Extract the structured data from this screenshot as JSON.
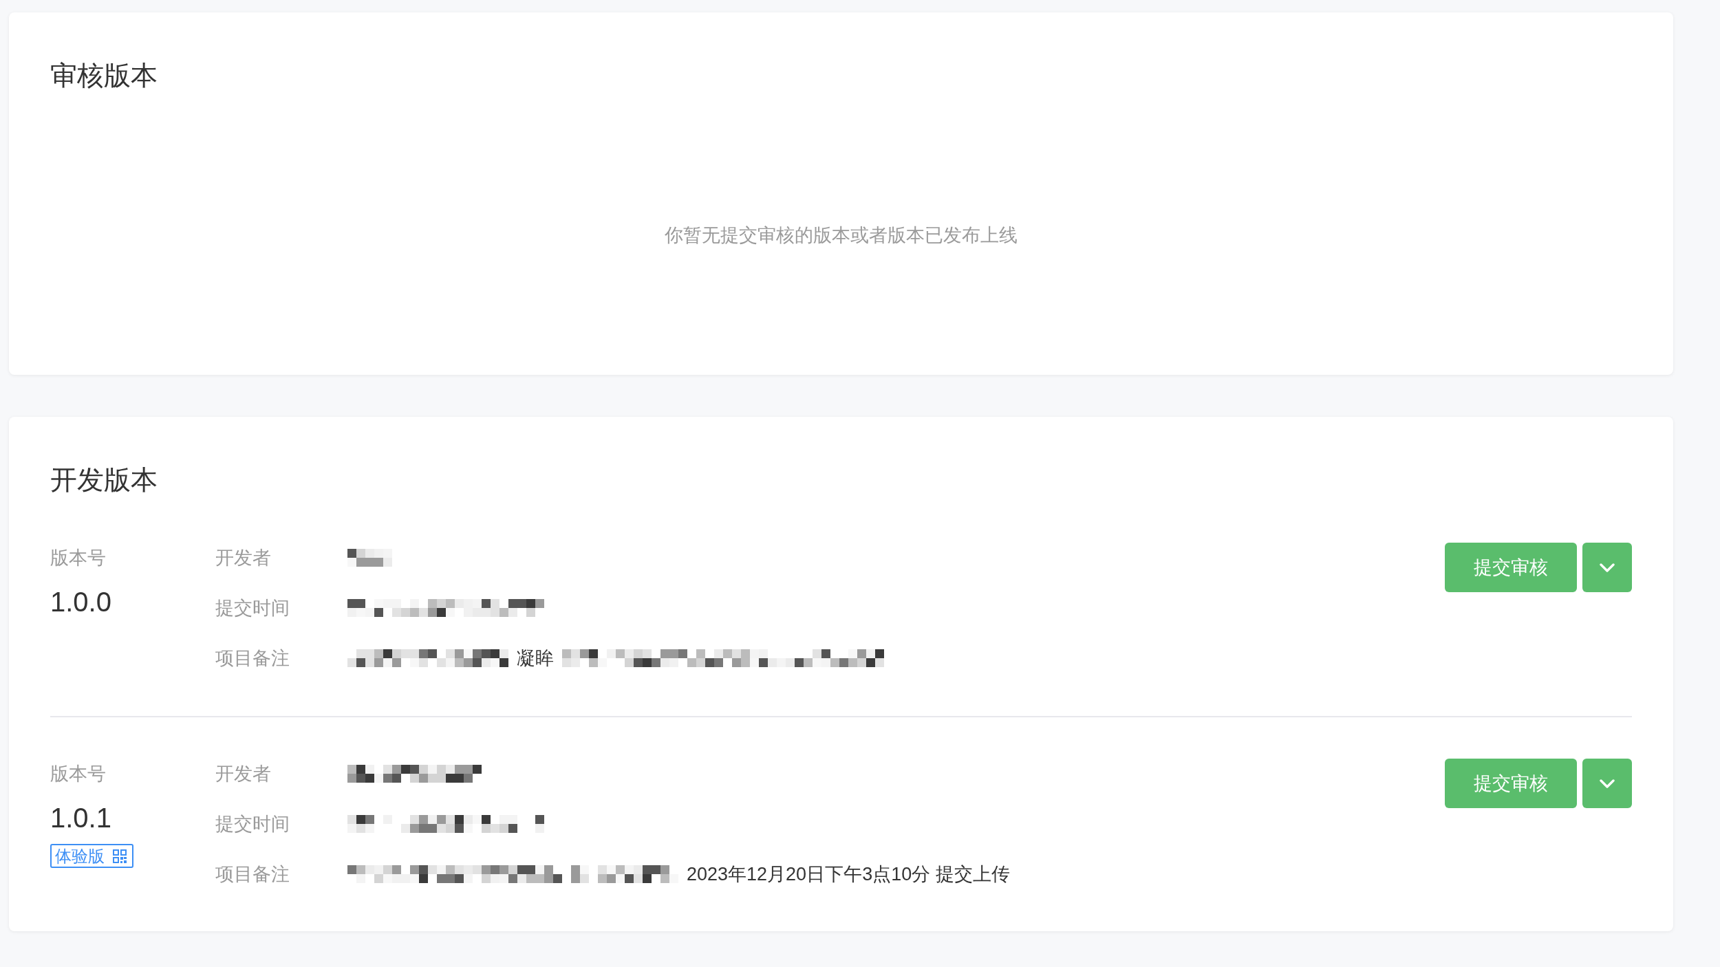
{
  "review_section": {
    "title": "审核版本",
    "empty_message": "你暂无提交审核的版本或者版本已发布上线"
  },
  "dev_section": {
    "title": "开发版本",
    "versions": [
      {
        "version_label": "版本号",
        "version": "1.0.0",
        "fields": [
          {
            "label": "开发者",
            "segments": [
              {
                "kind": "mosaic"
              }
            ]
          },
          {
            "label": "提交时间",
            "segments": [
              {
                "kind": "mosaic"
              }
            ]
          },
          {
            "label": "项目备注",
            "segments": [
              {
                "kind": "mosaic"
              },
              {
                "kind": "text",
                "text": "凝眸"
              },
              {
                "kind": "mosaic"
              }
            ]
          }
        ],
        "submit_button": "提交审核"
      },
      {
        "version_label": "版本号",
        "version": "1.0.1",
        "tag": {
          "label": "体验版"
        },
        "fields": [
          {
            "label": "开发者",
            "segments": [
              {
                "kind": "mosaic"
              }
            ]
          },
          {
            "label": "提交时间",
            "segments": [
              {
                "kind": "mosaic"
              }
            ]
          },
          {
            "label": "项目备注",
            "segments": [
              {
                "kind": "mosaic"
              },
              {
                "kind": "text",
                "text": "2023年12月20日下午3点10分 提交上传"
              }
            ]
          }
        ],
        "submit_button": "提交审核"
      }
    ]
  }
}
